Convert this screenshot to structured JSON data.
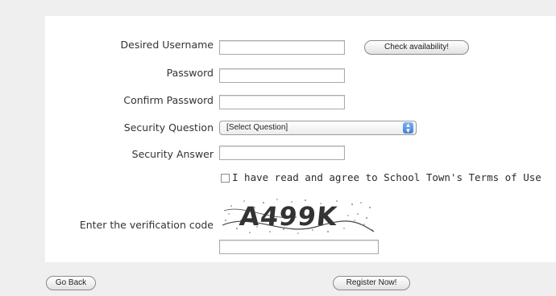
{
  "form": {
    "username_label": "Desired Username",
    "username_value": "",
    "check_label": "Check availability!",
    "password_label": "Password",
    "confirm_label": "Confirm Password",
    "security_question_label": "Security Question",
    "security_question_selected": "[Select Question]",
    "security_answer_label": "Security Answer",
    "terms_text": "I have read and agree to School Town's Terms of Use",
    "terms_checked": false,
    "verification_label": "Enter the verification code",
    "captcha_text": "A499K"
  },
  "actions": {
    "back_label": "Go Back",
    "register_label": "Register Now!"
  }
}
